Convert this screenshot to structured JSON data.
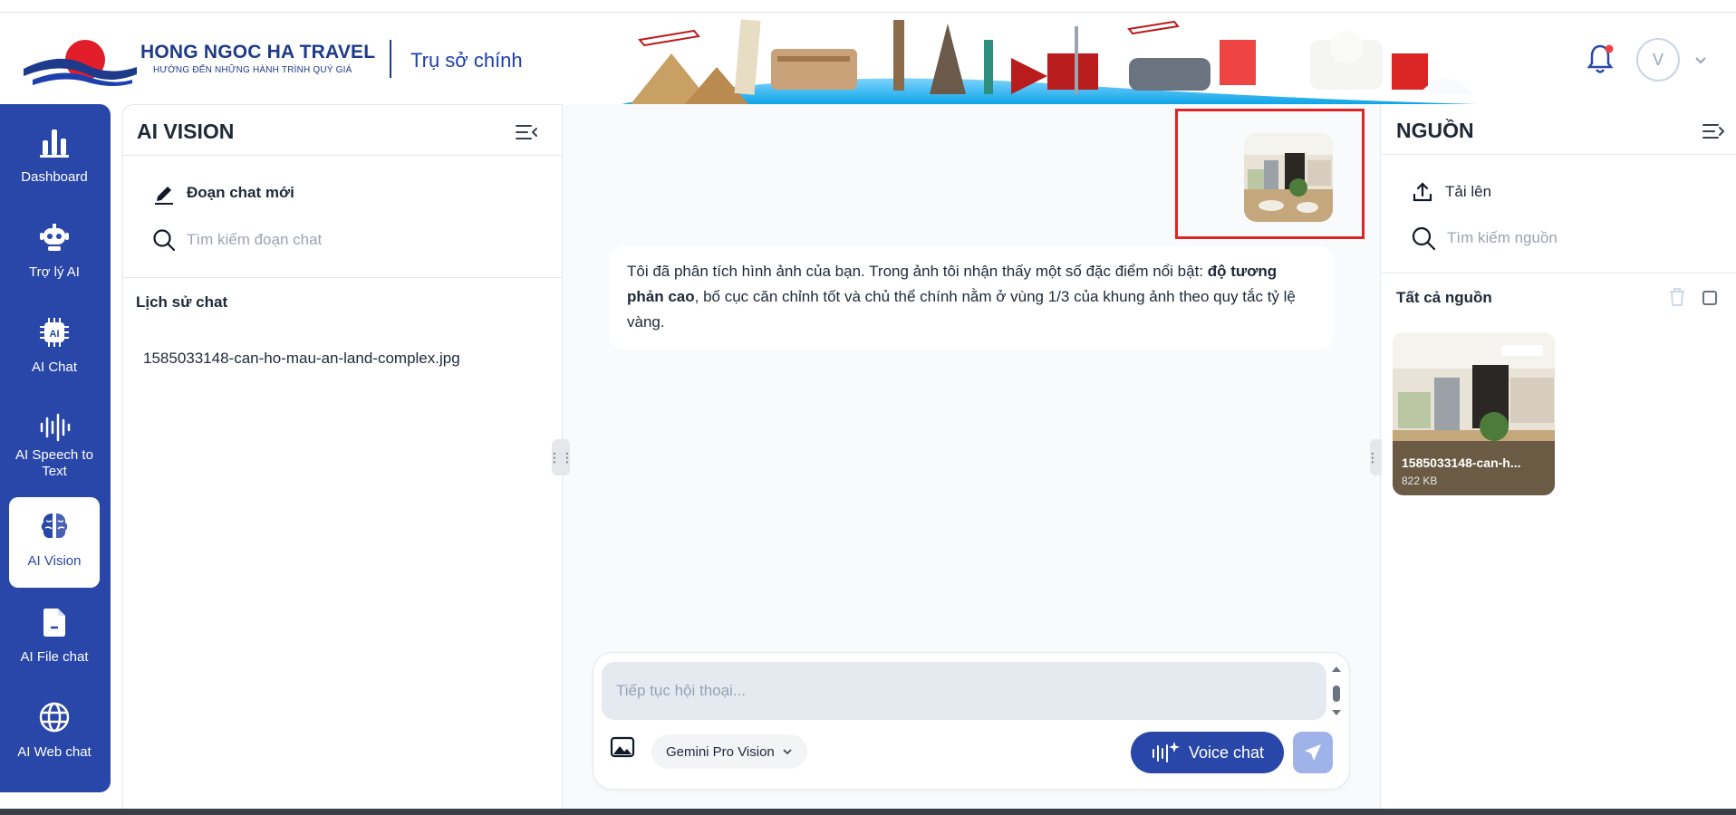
{
  "header": {
    "brand_name": "HONG NGOC HA TRAVEL",
    "brand_tagline": "HƯỚNG ĐẾN NHỮNG HÀNH TRÌNH QUÝ GIÁ",
    "branch": "Trụ sở chính",
    "avatar_initial": "V"
  },
  "nav": {
    "items": [
      {
        "label": "Dashboard",
        "icon": "bar-chart-icon"
      },
      {
        "label": "Trợ lý AI",
        "icon": "robot-icon"
      },
      {
        "label": "AI Chat",
        "icon": "ai-chip-icon"
      },
      {
        "label": "AI Speech to Text",
        "icon": "waveform-icon"
      },
      {
        "label": "AI Vision",
        "icon": "brain-icon",
        "active": true
      },
      {
        "label": "AI File chat",
        "icon": "file-icon"
      },
      {
        "label": "AI Web chat",
        "icon": "globe-icon"
      }
    ]
  },
  "history_panel": {
    "title": "AI VISION",
    "new_chat_label": "Đoạn chat mới",
    "search_placeholder": "Tìm kiếm đoạn chat",
    "history_label": "Lịch sử chat",
    "items": [
      "1585033148-can-ho-mau-an-land-complex.jpg"
    ]
  },
  "chat": {
    "reply_part1": "Tôi đã phân tích hình ảnh của bạn. Trong ảnh tôi nhận thấy một số đặc điểm nổi bật: ",
    "reply_bold": "độ tương phản cao",
    "reply_part2": ", bố cục căn chỉnh tốt và chủ thể chính nằm ở vùng 1/3 của khung ảnh theo quy tắc tỷ lệ vàng.",
    "input_placeholder": "Tiếp tục hội thoại...",
    "model_label": "Gemini Pro Vision",
    "voice_label": "Voice chat"
  },
  "sources_panel": {
    "title": "NGUỒN",
    "upload_label": "Tải lên",
    "search_placeholder": "Tìm kiếm nguồn",
    "all_sources_label": "Tất cả nguồn",
    "files": [
      {
        "name": "1585033148-can-h...",
        "size": "822 KB"
      }
    ]
  },
  "colors": {
    "primary": "#2947a9",
    "highlight_border": "#dc2626",
    "notification_dot": "#ef4444"
  }
}
